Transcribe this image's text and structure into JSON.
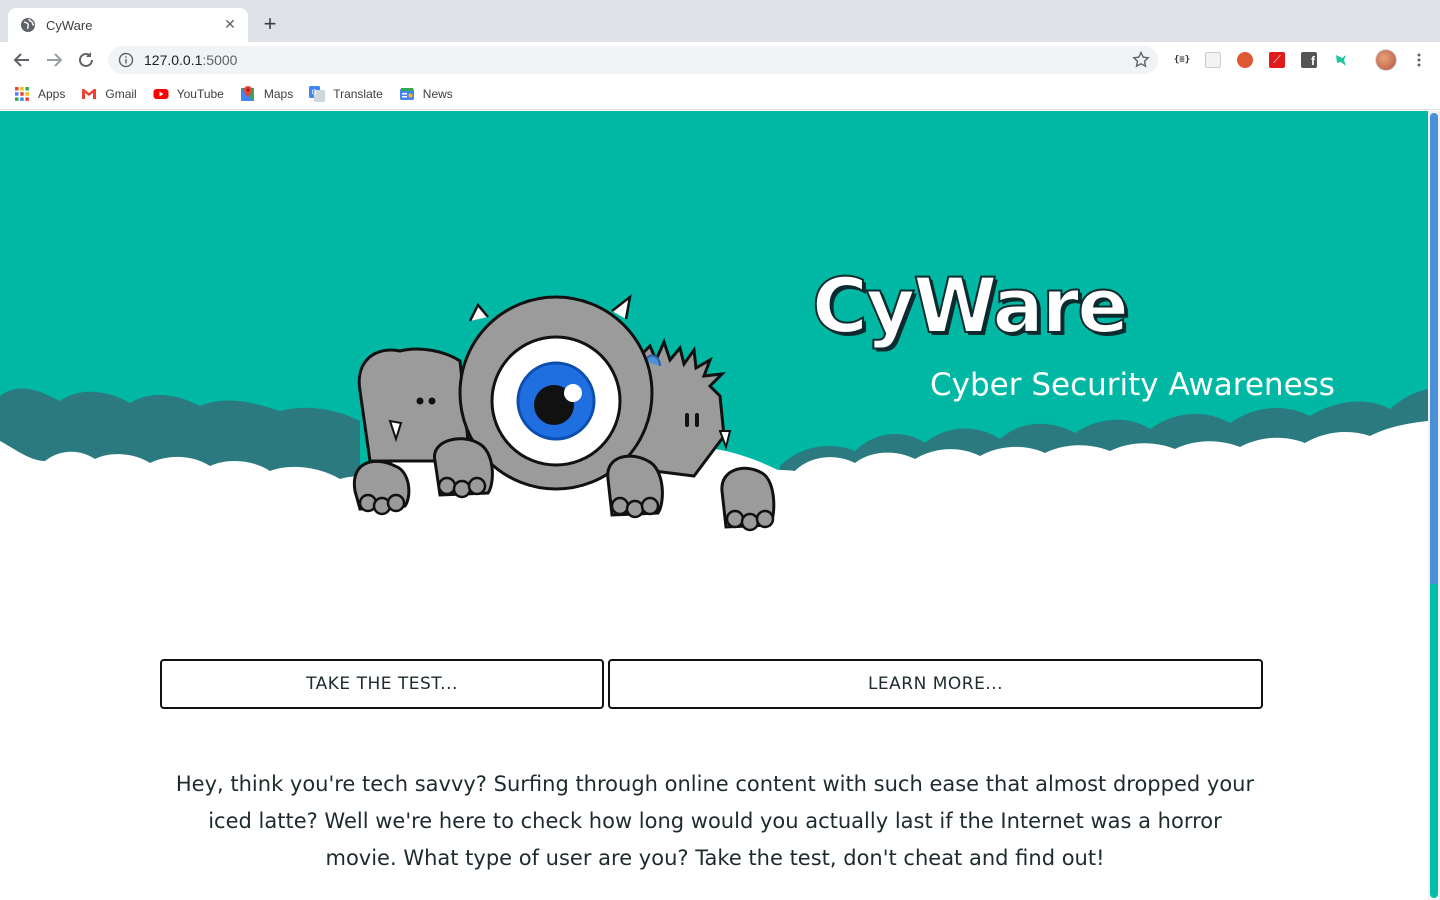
{
  "browser": {
    "tab": {
      "title": "CyWare",
      "close": "✕"
    },
    "new_tab": "+",
    "url": {
      "host": "127.0.0.1",
      "port": ":5000"
    },
    "bookmarks": [
      {
        "label": "Apps",
        "icon": "apps-grid-icon"
      },
      {
        "label": "Gmail",
        "icon": "gmail-icon"
      },
      {
        "label": "YouTube",
        "icon": "youtube-icon"
      },
      {
        "label": "Maps",
        "icon": "maps-icon"
      },
      {
        "label": "Translate",
        "icon": "translate-icon"
      },
      {
        "label": "News",
        "icon": "news-icon"
      }
    ],
    "extensions": [
      "json-formatter-icon",
      "blank-extension-icon",
      "duckduckgo-icon",
      "pdf-icon",
      "facebook-icon",
      "hummingbird-icon",
      "profile-avatar-icon",
      "menu-dots-icon"
    ],
    "ext_label_json": "{≡}"
  },
  "hero": {
    "brand": "CyWare",
    "subtitle": "Cyber Security Awareness",
    "colors": {
      "teal": "#00b8a4",
      "dark_teal": "#2a7a80",
      "cloud": "#ffffff"
    }
  },
  "actions": {
    "take_test": "TAKE THE TEST...",
    "learn_more": "LEARN MORE..."
  },
  "intro": {
    "text": "Hey, think you're tech savvy? Surfing through online content with such ease that almost dropped your iced latte? Well we're here to check how long would you actually last if the Internet was a horror movie. What type of user are you? Take the test, don't cheat and find out!"
  }
}
